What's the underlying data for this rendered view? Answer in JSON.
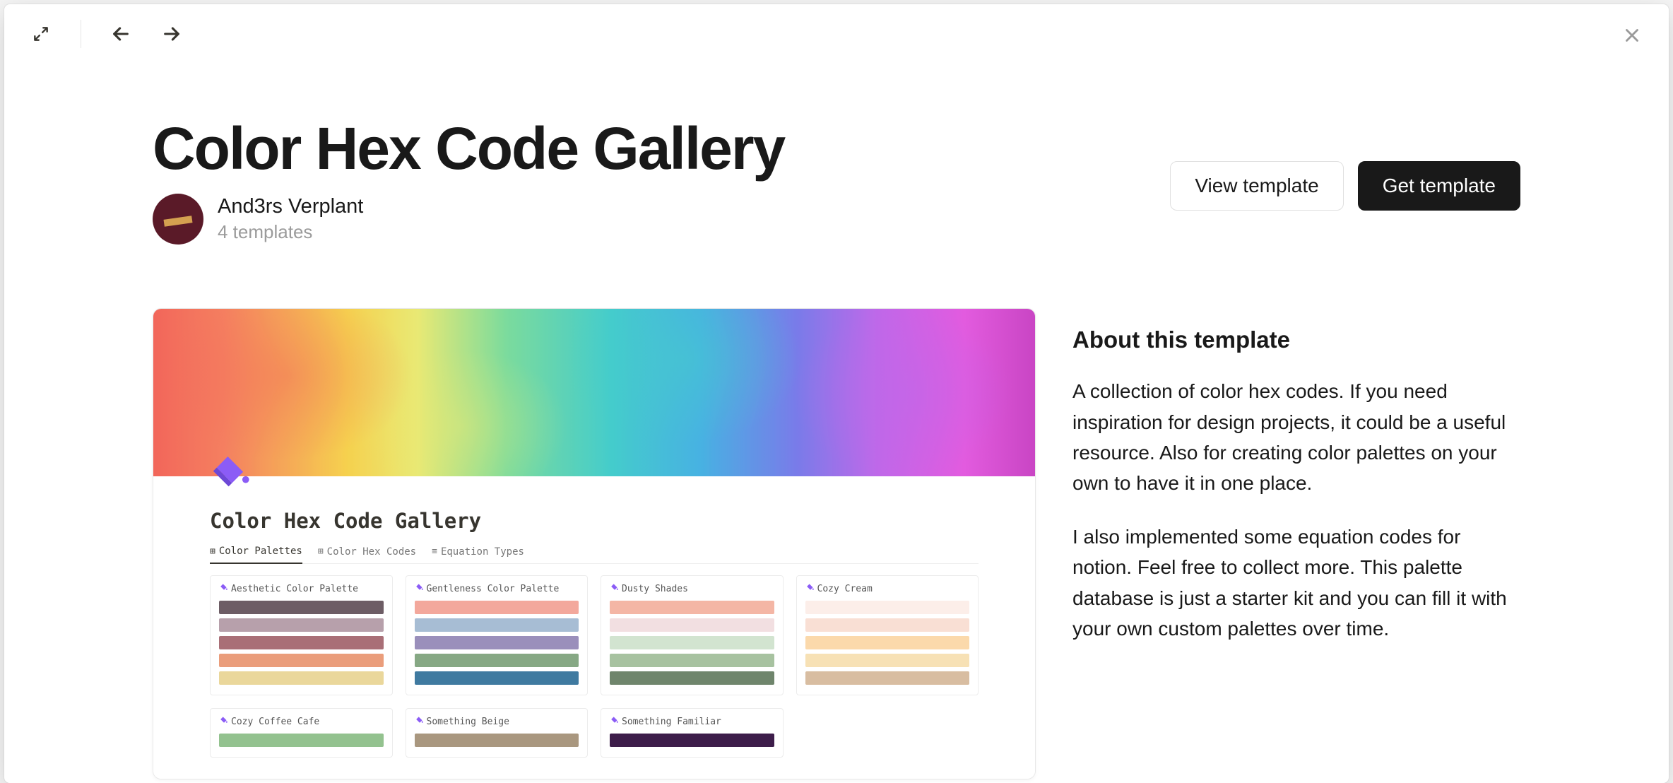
{
  "header": {
    "title": "Color Hex Code Gallery",
    "author_name": "And3rs Verplant",
    "template_count": "4 templates"
  },
  "actions": {
    "view_label": "View template",
    "get_label": "Get template"
  },
  "about": {
    "heading": "About this template",
    "para1": "A collection of color hex codes. If you need inspiration for design projects, it could be a useful resource. Also for creating color palettes on your own to have it in one place.",
    "para2": "I also implemented some equation codes for notion. Feel free to collect more. This palette database is just a starter kit and you can fill it with your own custom palettes over time."
  },
  "preview": {
    "title": "Color Hex Code Gallery",
    "tabs": [
      {
        "label": "Color Palettes"
      },
      {
        "label": "Color Hex Codes"
      },
      {
        "label": "Equation Types"
      }
    ],
    "palettes": [
      {
        "name": "Aesthetic Color Palette",
        "colors": [
          "#6d5d65",
          "#b7a0ab",
          "#a96f77",
          "#ea9d7b",
          "#ead79b"
        ]
      },
      {
        "name": "Gentleness Color Palette",
        "colors": [
          "#f3a89c",
          "#a7bdd4",
          "#9a8fbb",
          "#86a884",
          "#3f7aa0"
        ]
      },
      {
        "name": "Dusty Shades",
        "colors": [
          "#f4b6a5",
          "#f2dfe1",
          "#d2e4d0",
          "#a7c2a0",
          "#6f856c"
        ]
      },
      {
        "name": "Cozy Cream",
        "colors": [
          "#fceee9",
          "#f9dfd4",
          "#fbd9ab",
          "#f7e1b5",
          "#d8bda1"
        ]
      },
      {
        "name": "Cozy Coffee Cafe",
        "colors": [
          "#93c28f"
        ]
      },
      {
        "name": "Something Beige",
        "colors": [
          "#a9977f"
        ]
      },
      {
        "name": "Something Familiar",
        "colors": [
          "#3d1d4a"
        ]
      }
    ]
  }
}
